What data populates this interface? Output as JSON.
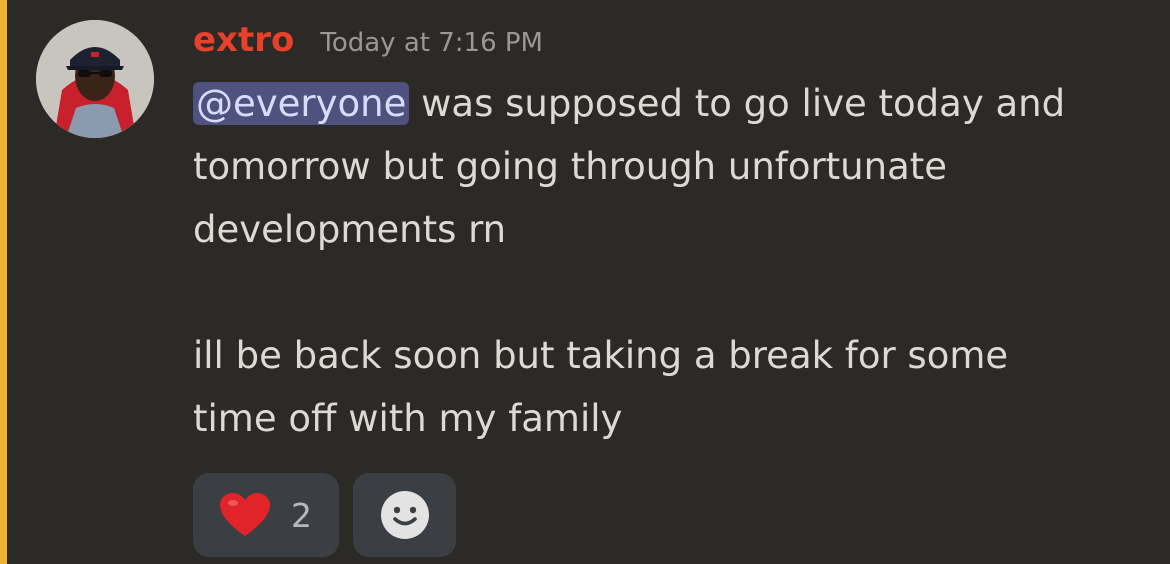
{
  "message": {
    "author": "extro",
    "timestamp": "Today at 7:16 PM",
    "mention": "@everyone",
    "lines": [
      " was supposed to go live today and",
      "tomorrow but going through unfortunate",
      "developments rn",
      "ill be back soon but taking a break for some",
      "time off with my family"
    ]
  },
  "reactions": [
    {
      "icon": "heart-emoji",
      "count": "2"
    }
  ],
  "add_reaction": {
    "icon": "smiley-icon"
  },
  "colors": {
    "background": "#2c2a27",
    "mention_bar": "#f0b232",
    "username": "#e8402a",
    "mention_bg": "#4f527f",
    "reaction_bg": "#3b3f44"
  }
}
